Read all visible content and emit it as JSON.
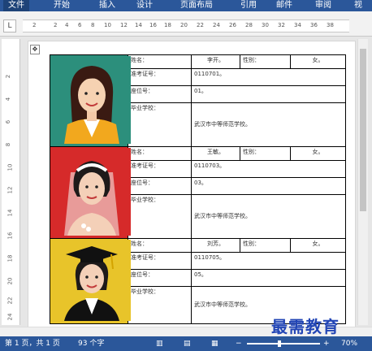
{
  "ribbon": {
    "tabs": [
      "文件",
      "开始",
      "插入",
      "设计",
      "页面布局",
      "引用",
      "邮件",
      "审阅",
      "视"
    ]
  },
  "ruler": {
    "corner": "L",
    "ticks": [
      "2",
      "2",
      "4",
      "6",
      "8",
      "10",
      "12",
      "14",
      "16",
      "18",
      "20",
      "22",
      "24",
      "26",
      "28",
      "30",
      "32",
      "34",
      "36",
      "38"
    ],
    "vticks": [
      "2",
      "4",
      "6",
      "8",
      "10",
      "12",
      "14",
      "16",
      "18",
      "20",
      "22",
      "24"
    ]
  },
  "form": {
    "records": [
      {
        "name_label": "姓名：",
        "name_value": "李开。",
        "gender_label": "性别：",
        "gender_value": "女。",
        "exam_label": "准考证号：",
        "exam_value": "0110701。",
        "seat_label": "座位号：",
        "seat_value": "01。",
        "school_label": "毕业学校：",
        "school_value": "武汉市中等师范学校。"
      },
      {
        "name_label": "姓名：",
        "name_value": "王敏。",
        "gender_label": "性别：",
        "gender_value": "女。",
        "exam_label": "准考证号：",
        "exam_value": "0110703。",
        "seat_label": "座位号：",
        "seat_value": "03。",
        "school_label": "毕业学校：",
        "school_value": "武汉市中等师范学校。"
      },
      {
        "name_label": "姓名：",
        "name_value": "刘芳。",
        "gender_label": "性别：",
        "gender_value": "女。",
        "exam_label": "准考证号：",
        "exam_value": "0110705。",
        "seat_label": "座位号：",
        "seat_value": "05。",
        "school_label": "毕业学校：",
        "school_value": "武汉市中等师范学校。"
      }
    ]
  },
  "status": {
    "page": "第 1 页，共 1 页",
    "words": "93 个字",
    "zoom": "70%"
  },
  "watermark": "最需教育",
  "colors": {
    "ribbon": "#2b579a",
    "photo1_bg": "#2c8f7c",
    "photo2_bg": "#d62a2a",
    "photo3_bg": "#e8c42a"
  }
}
